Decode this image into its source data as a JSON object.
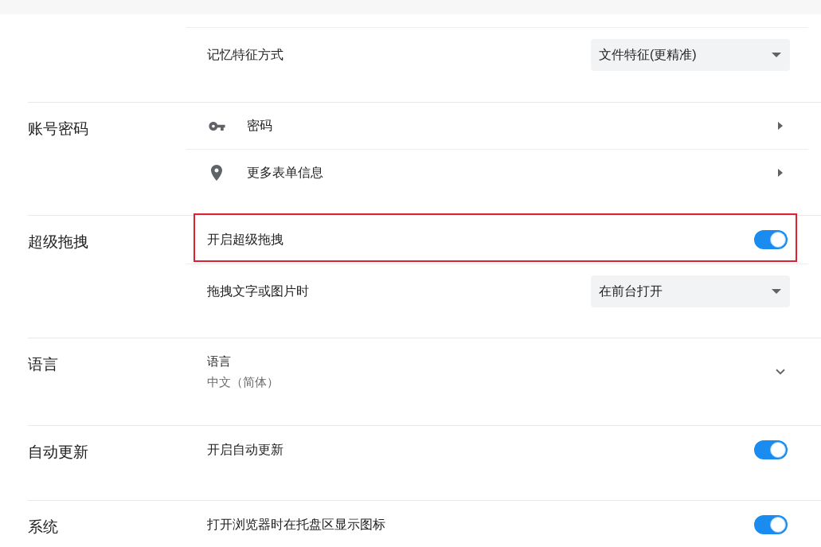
{
  "sections": [
    {
      "rows": [
        {
          "kind": "select",
          "label": "记忆特征方式",
          "value": "文件特征(更精准)",
          "highlighted": false
        }
      ]
    },
    {
      "label": "账号密码",
      "rows": [
        {
          "kind": "link",
          "label": "密码",
          "highlighted": false
        },
        {
          "kind": "link",
          "label": "更多表单信息",
          "highlighted": false
        }
      ]
    },
    {
      "label": "超级拖拽",
      "rows": [
        {
          "kind": "toggle",
          "label": "开启超级拖拽",
          "on": true,
          "highlighted": true
        },
        {
          "kind": "select",
          "label": "拖拽文字或图片时",
          "value": "在前台打开",
          "highlighted": false
        }
      ]
    },
    {
      "label": "语言",
      "rows": [
        {
          "kind": "expand",
          "label": "语言",
          "value": "中文（简体）",
          "expanded": false,
          "highlighted": false
        }
      ]
    },
    {
      "label": "自动更新",
      "rows": [
        {
          "kind": "toggle",
          "label": "开启自动更新",
          "on": true,
          "highlighted": false
        }
      ]
    },
    {
      "label": "系统",
      "rows": [
        {
          "kind": "toggle",
          "label": "打开浏览器时在托盘区显示图标",
          "on": true,
          "highlighted": false
        }
      ]
    }
  ]
}
